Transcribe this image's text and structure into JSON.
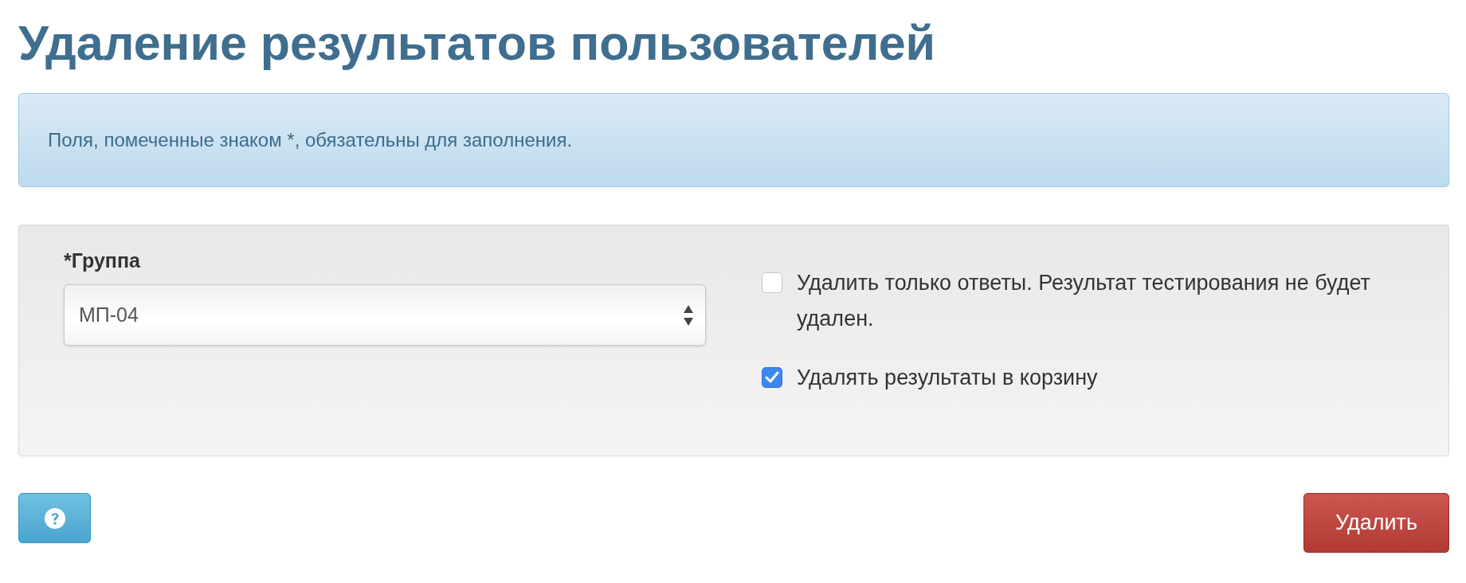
{
  "title": "Удаление результатов пользователей",
  "notice": "Поля, помеченные знаком *, обязательны для заполнения.",
  "form": {
    "group_label": "*Группа",
    "group_value": "МП-04",
    "options": [
      {
        "label": "Удалить только ответы. Результат тестирования не будет удален.",
        "checked": false
      },
      {
        "label": "Удалять результаты в корзину",
        "checked": true
      }
    ]
  },
  "buttons": [
    {
      "kind": "help"
    },
    {
      "kind": "danger",
      "label": "Удалить"
    }
  ]
}
